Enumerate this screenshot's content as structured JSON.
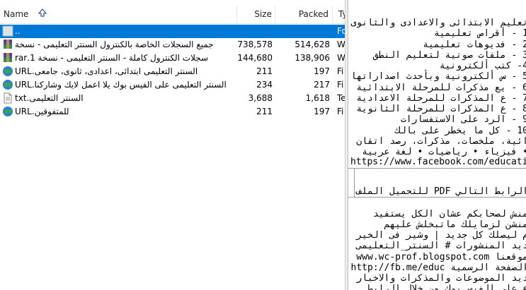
{
  "header": {
    "name": "Name",
    "size": "Size",
    "packed": "Packed",
    "type": "Ty"
  },
  "rows": [
    {
      "name": "..",
      "size": "",
      "packed": "",
      "type": "Fo",
      "icon": "folder-icon",
      "selected": true
    },
    {
      "name": "جميع السجلات الخاصة بالكنترول السنتر التعليمى - نسخة",
      "size": "738,578",
      "packed": "514,628",
      "type": "W",
      "icon": "rar-archive-icon",
      "selected": false
    },
    {
      "name": "سجلات الكنترول كاملة - السنتر التعليمى - نسخة 1.rar",
      "size": "144,680",
      "packed": "138,906",
      "type": "W",
      "icon": "rar-archive-icon",
      "selected": false
    },
    {
      "name": "السنتر التعليمى ابتدائى، اعدادى، ثانوى، جامعى.URL",
      "size": "211",
      "packed": "197",
      "type": "Fi",
      "icon": "internet-shortcut-icon",
      "selected": false
    },
    {
      "name": "السنتر التعليمى على الفيس بوك يلا اعمل لايك وشاركنا.URL",
      "size": "234",
      "packed": "217",
      "type": "Fi",
      "icon": "internet-shortcut-icon",
      "selected": false
    },
    {
      "name": "السنتر التعليمى.txt",
      "size": "3,688",
      "packed": "1,618",
      "type": "Te",
      "icon": "text-file-icon",
      "selected": false
    },
    {
      "name": "للمتفوقين.URL",
      "size": "211",
      "packed": "197",
      "type": "Fi",
      "icon": "internet-shortcut-icon",
      "selected": false
    }
  ],
  "preview": {
    "lines": [
      "تعليم الابتدائى والاعدادى والثانوى",
      "1 - أقراص تعليمية",
      "2 - فديوهات تعليمية",
      "3 - ملفات صوتية لتعليم النطق",
      "4- كتب ألكترونية",
      "5 - س ألكترونية وبأحدث اصداراتها",
      "6 - يع مذكرات للمرحلة الابتدائية",
      "7 - ع المذكرات للمرحلة الاعدادية",
      "8 - ع المذكرات للمرحلة الثانوية",
      "9 - الرد على الاستفسارات",
      "10 - كل ما يخطر على بالك",
      "ائية، ملخصات، مذكرات، رصد اتقان",
      "• فيزياء • رياضيات • لغة عربية"
    ],
    "url1": "https://www.facebook.com/educati",
    "pdf_line": "الرابط التالي PDF للتحميل الملف",
    "lines2": [
      "منش لصحابكم عشان الكل يستفيد",
      "منشن لزمايلك ماتبخلش عليهم",
      "م ليصلك كل جديد | وشير فى الخير",
      "ديد المنشورات # السنتر_التعليمى"
    ],
    "site_line": "موقعنا www.wc-prof.blogspot.com",
    "fb_line": "الصفحة الرسمية http://fb.me/educ",
    "lines3": [
      "ديد الموضوعات والمذكرات والاخبار",
      "ع على الفيس بوك من خلال الرابط"
    ]
  }
}
